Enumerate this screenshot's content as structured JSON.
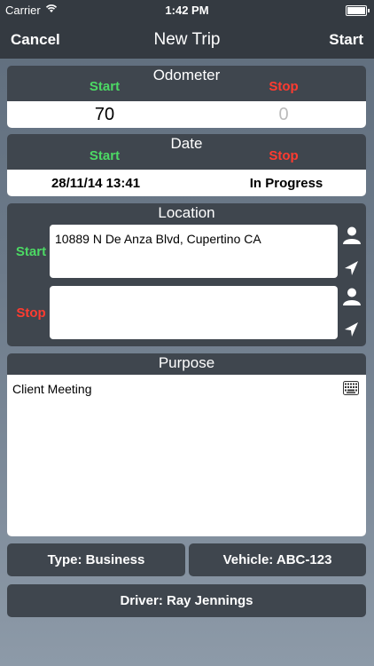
{
  "status": {
    "carrier": "Carrier",
    "time": "1:42 PM"
  },
  "nav": {
    "left": "Cancel",
    "title": "New Trip",
    "right": "Start"
  },
  "odometer": {
    "title": "Odometer",
    "start_label": "Start",
    "stop_label": "Stop",
    "start_value": "70",
    "stop_value": "0"
  },
  "date": {
    "title": "Date",
    "start_label": "Start",
    "stop_label": "Stop",
    "start_value": "28/11/14 13:41",
    "stop_value": "In Progress"
  },
  "location": {
    "title": "Location",
    "start_label": "Start",
    "stop_label": "Stop",
    "start_value": "10889 N De Anza Blvd, Cupertino CA",
    "stop_value": ""
  },
  "purpose": {
    "title": "Purpose",
    "value": "Client Meeting"
  },
  "buttons": {
    "type": "Type: Business",
    "vehicle": "Vehicle: ABC-123",
    "driver": "Driver: Ray Jennings"
  },
  "colors": {
    "start": "#4cd964",
    "stop": "#ff3b30",
    "panel": "#3f464e",
    "nav": "#343a41"
  },
  "icons": [
    "wifi-icon",
    "battery-icon",
    "contact-icon",
    "location-arrow-icon",
    "keyboard-icon"
  ]
}
